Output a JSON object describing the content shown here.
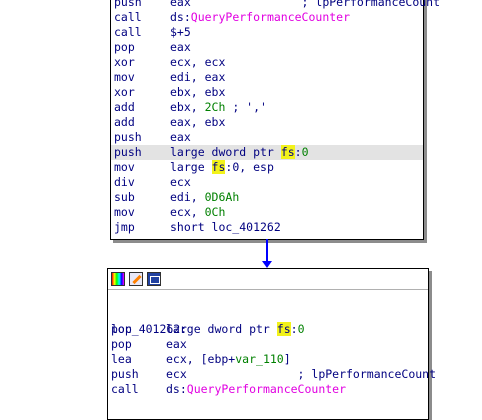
{
  "block1": {
    "lines": [
      {
        "mnemonic": "push",
        "ops": [
          {
            "t": "eax                ; lpPerformanceCount",
            "c": ""
          }
        ]
      },
      {
        "mnemonic": "call",
        "ops": [
          {
            "t": "ds:",
            "c": ""
          },
          {
            "t": "QueryPerformanceCounter",
            "c": "mag"
          }
        ]
      },
      {
        "mnemonic": "call",
        "ops": [
          {
            "t": "$+5",
            "c": ""
          }
        ]
      },
      {
        "mnemonic": "pop",
        "ops": [
          {
            "t": "eax",
            "c": ""
          }
        ]
      },
      {
        "mnemonic": "xor",
        "ops": [
          {
            "t": "ecx, ecx",
            "c": ""
          }
        ]
      },
      {
        "mnemonic": "mov",
        "ops": [
          {
            "t": "edi, eax",
            "c": ""
          }
        ]
      },
      {
        "mnemonic": "xor",
        "ops": [
          {
            "t": "ebx, ebx",
            "c": ""
          }
        ]
      },
      {
        "mnemonic": "add",
        "ops": [
          {
            "t": "ebx, ",
            "c": ""
          },
          {
            "t": "2Ch",
            "c": "grn"
          },
          {
            "t": " ; ','",
            "c": ""
          }
        ]
      },
      {
        "mnemonic": "add",
        "ops": [
          {
            "t": "eax, ebx",
            "c": ""
          }
        ]
      },
      {
        "mnemonic": "push",
        "ops": [
          {
            "t": "eax",
            "c": ""
          }
        ]
      },
      {
        "mnemonic": "push",
        "ops": [
          {
            "t": "large dword ptr ",
            "c": ""
          },
          {
            "t": "fs",
            "c": "hlw"
          },
          {
            "t": ":",
            "c": ""
          },
          {
            "t": "0",
            "c": "grn"
          }
        ],
        "highlight": true
      },
      {
        "mnemonic": "mov",
        "ops": [
          {
            "t": "large ",
            "c": ""
          },
          {
            "t": "fs",
            "c": "hlw"
          },
          {
            "t": ":0, esp",
            "c": ""
          }
        ]
      },
      {
        "mnemonic": "div",
        "ops": [
          {
            "t": "ecx",
            "c": ""
          }
        ]
      },
      {
        "mnemonic": "sub",
        "ops": [
          {
            "t": "edi, ",
            "c": ""
          },
          {
            "t": "0D6Ah",
            "c": "grn"
          }
        ]
      },
      {
        "mnemonic": "mov",
        "ops": [
          {
            "t": "ecx, ",
            "c": ""
          },
          {
            "t": "0Ch",
            "c": "grn"
          }
        ]
      },
      {
        "mnemonic": "jmp",
        "ops": [
          {
            "t": "short loc_401262",
            "c": ""
          }
        ]
      }
    ]
  },
  "block2": {
    "icons": [
      "color-palette-icon",
      "rename-icon",
      "graph-view-icon"
    ],
    "label": "loc_401262:",
    "lines": [
      {
        "mnemonic": "pop",
        "ops": [
          {
            "t": "large dword ptr ",
            "c": ""
          },
          {
            "t": "fs",
            "c": "hlw"
          },
          {
            "t": ":",
            "c": ""
          },
          {
            "t": "0",
            "c": "grn"
          }
        ]
      },
      {
        "mnemonic": "pop",
        "ops": [
          {
            "t": "eax",
            "c": ""
          }
        ]
      },
      {
        "mnemonic": "lea",
        "ops": [
          {
            "t": "ecx, [ebp+",
            "c": ""
          },
          {
            "t": "var_110",
            "c": "grn"
          },
          {
            "t": "]",
            "c": ""
          }
        ]
      },
      {
        "mnemonic": "push",
        "ops": [
          {
            "t": "ecx                ; lpPerformanceCount",
            "c": ""
          }
        ]
      },
      {
        "mnemonic": "call",
        "ops": [
          {
            "t": "ds:",
            "c": ""
          },
          {
            "t": "QueryPerformanceCounter",
            "c": "mag"
          }
        ]
      }
    ]
  },
  "colors": {
    "text": "#000080",
    "import_name": "#e100e1",
    "immediate": "#008000",
    "highlight": "#f2f21a",
    "selected_line": "#e3e3e3",
    "edge": "#0000ff"
  }
}
